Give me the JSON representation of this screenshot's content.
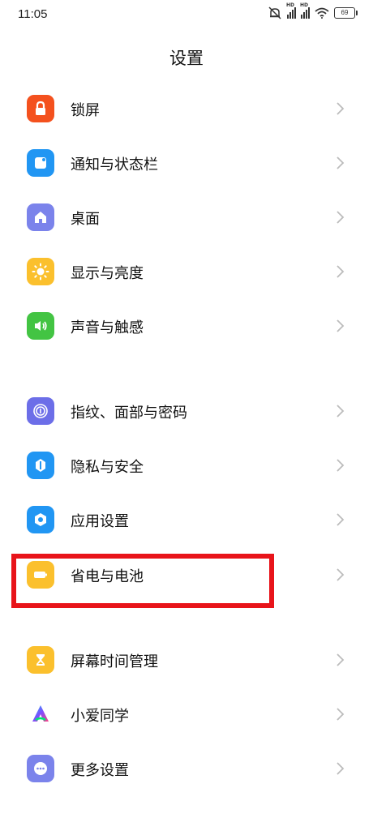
{
  "status_bar": {
    "time": "11:05",
    "battery": "69",
    "network_label": "HD"
  },
  "page": {
    "title": "设置"
  },
  "settings": [
    {
      "label": "锁屏",
      "icon": "lock-icon",
      "color": "#f4511e"
    },
    {
      "label": "通知与状态栏",
      "icon": "notification-icon",
      "color": "#2196f3"
    },
    {
      "label": "桌面",
      "icon": "home-icon",
      "color": "#7b83eb"
    },
    {
      "label": "显示与亮度",
      "icon": "sun-icon",
      "color": "#fbc02d"
    },
    {
      "label": "声音与触感",
      "icon": "speaker-icon",
      "color": "#43c443"
    },
    {
      "label": "指纹、面部与密码",
      "icon": "fingerprint-icon",
      "color": "#6c6ee8"
    },
    {
      "label": "隐私与安全",
      "icon": "privacy-icon",
      "color": "#2196f3"
    },
    {
      "label": "应用设置",
      "icon": "app-settings-icon",
      "color": "#2196f3"
    },
    {
      "label": "省电与电池",
      "icon": "battery-icon",
      "color": "#fbc02d"
    },
    {
      "label": "屏幕时间管理",
      "icon": "hourglass-icon",
      "color": "#fbc02d"
    },
    {
      "label": "小爱同学",
      "icon": "xiaoai-icon",
      "color": "#7c4dff"
    },
    {
      "label": "更多设置",
      "icon": "more-icon",
      "color": "#7b83eb"
    }
  ],
  "annotation": {
    "highlight_color": "#e8141a"
  }
}
